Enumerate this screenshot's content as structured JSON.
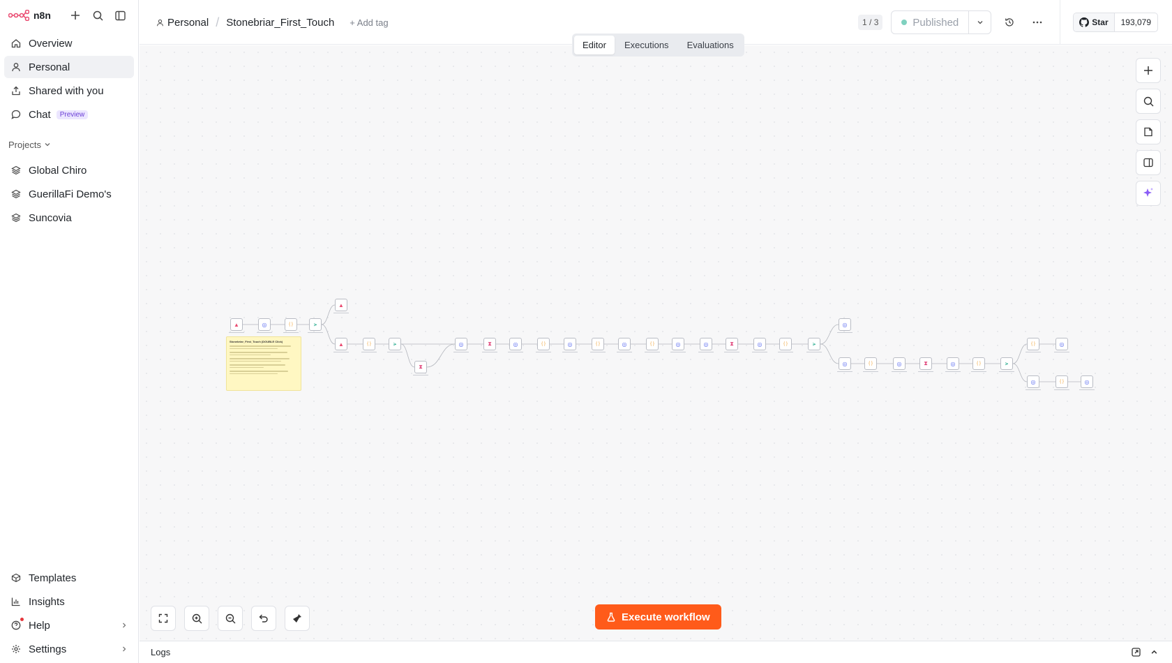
{
  "app": {
    "name": "n8n"
  },
  "sidebar": {
    "nav": [
      {
        "label": "Overview",
        "icon": "home-icon"
      },
      {
        "label": "Personal",
        "icon": "user-icon",
        "active": true
      },
      {
        "label": "Shared with you",
        "icon": "share-icon"
      },
      {
        "label": "Chat",
        "icon": "chat-icon",
        "badge": "Preview"
      }
    ],
    "projects_label": "Projects",
    "projects": [
      {
        "label": "Global Chiro",
        "icon": "layers-icon"
      },
      {
        "label": "GuerillaFi Demo's",
        "icon": "layers-icon"
      },
      {
        "label": "Suncovia",
        "icon": "layers-icon"
      }
    ],
    "bottom": [
      {
        "label": "Templates",
        "icon": "templates-icon"
      },
      {
        "label": "Insights",
        "icon": "chart-icon"
      },
      {
        "label": "Help",
        "icon": "help-icon",
        "chevron": true
      },
      {
        "label": "Settings",
        "icon": "gear-icon",
        "chevron": true
      }
    ]
  },
  "header": {
    "breadcrumb_owner": "Personal",
    "workflow_name": "Stonebriar_First_Touch",
    "add_tag": "+ Add tag",
    "version_counter": "1 / 3",
    "publish_status": "Published",
    "github_star": "Star",
    "github_count": "193,079"
  },
  "tabs": [
    "Editor",
    "Executions",
    "Evaluations"
  ],
  "canvas": {
    "execute_label": "Execute workflow",
    "sticky_title": "Stonebriar_First_Touch (DOUBLE Click)",
    "accent": "#ff5b1a"
  },
  "logs": {
    "label": "Logs"
  }
}
